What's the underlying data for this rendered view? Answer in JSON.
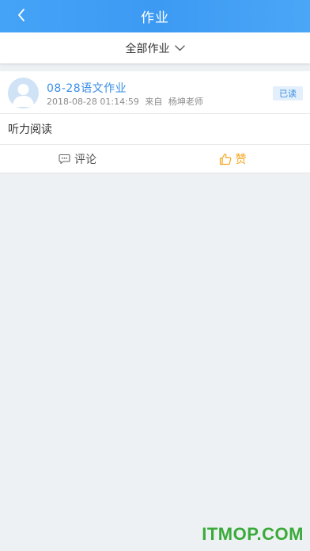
{
  "header": {
    "title": "作业",
    "back_icon": "back-chevron-icon"
  },
  "filter": {
    "label": "全部作业",
    "icon": "chevron-down-icon"
  },
  "homework": [
    {
      "title": "08-28语文作业",
      "datetime": "2018-08-28 01:14:59",
      "from_label": "来自",
      "teacher": "杨坤老师",
      "status": "已读",
      "content": "听力阅读",
      "actions": {
        "comment_label": "评论",
        "like_label": "赞"
      }
    }
  ],
  "watermark": "ITMOP.COM",
  "colors": {
    "header": "#3c9af3",
    "accent": "#3a8ee6",
    "like": "#f5a623",
    "background": "#eef1f4"
  }
}
